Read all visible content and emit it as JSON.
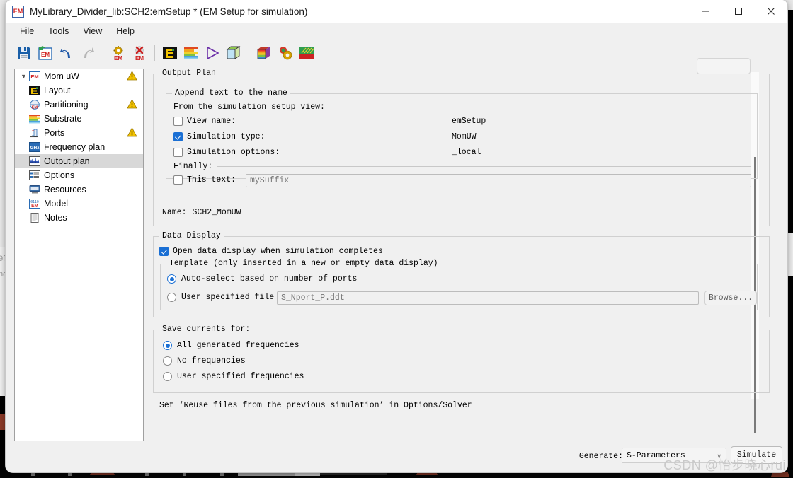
{
  "window": {
    "title": "MyLibrary_Divider_lib:SCH2:emSetup * (EM Setup for simulation)",
    "app_icon": "em-icon",
    "minimize": "—",
    "maximize": "☐",
    "close": "✕"
  },
  "menubar": [
    {
      "label": "File",
      "mnemonic": "F"
    },
    {
      "label": "Tools",
      "mnemonic": "T"
    },
    {
      "label": "View",
      "mnemonic": "V"
    },
    {
      "label": "Help",
      "mnemonic": "H"
    }
  ],
  "toolbar": [
    {
      "name": "save-icon"
    },
    {
      "name": "save-em-setup-icon"
    },
    {
      "name": "undo-icon"
    },
    {
      "name": "redo-icon"
    },
    {
      "sep": true
    },
    {
      "name": "em-settings-icon"
    },
    {
      "name": "em-delete-icon"
    },
    {
      "sep": true
    },
    {
      "name": "layout-icon"
    },
    {
      "name": "substrate-icon"
    },
    {
      "name": "simulate-play-icon"
    },
    {
      "name": "3d-view-icon"
    },
    {
      "sep": true
    },
    {
      "name": "3d-em-preview-icon"
    },
    {
      "name": "em-cosimulation-icon"
    },
    {
      "name": "current-visualization-icon"
    }
  ],
  "sidebar": {
    "root": {
      "label": "Mom uW",
      "icon": "em-icon",
      "expanded": true,
      "warning": true
    },
    "items": [
      {
        "label": "Layout",
        "icon": "layout-icon",
        "warning": false,
        "selected": false
      },
      {
        "label": "Partitioning",
        "icon": "partitioning-icon",
        "warning": true,
        "selected": false
      },
      {
        "label": "Substrate",
        "icon": "substrate-icon",
        "warning": false,
        "selected": false
      },
      {
        "label": "Ports",
        "icon": "ports-icon",
        "warning": true,
        "selected": false
      },
      {
        "label": "Frequency plan",
        "icon": "ghz-icon",
        "warning": false,
        "selected": false
      },
      {
        "label": "Output plan",
        "icon": "output-plan-icon",
        "warning": false,
        "selected": true
      },
      {
        "label": "Options",
        "icon": "options-icon",
        "warning": false,
        "selected": false
      },
      {
        "label": "Resources",
        "icon": "resources-icon",
        "warning": false,
        "selected": false
      },
      {
        "label": "Model",
        "icon": "model-icon",
        "warning": false,
        "selected": false
      },
      {
        "label": "Notes",
        "icon": "notes-icon",
        "warning": false,
        "selected": false
      }
    ]
  },
  "output_plan": {
    "group_label": "Output Plan",
    "append_group_label": "Append text to the name",
    "from_view_label": "From the simulation setup view:",
    "rows": [
      {
        "label": "View name:",
        "checked": false,
        "value": "emSetup"
      },
      {
        "label": "Simulation type:",
        "checked": true,
        "value": "MomUW"
      },
      {
        "label": "Simulation options:",
        "checked": false,
        "value": "_local"
      }
    ],
    "finally_label": "Finally:",
    "this_text_label": "This text:",
    "this_text_checked": false,
    "this_text_placeholder": "mySuffix",
    "this_text_value": "",
    "name_label": "Name:",
    "name_value": "SCH2_MomUW"
  },
  "data_display": {
    "group_label": "Data Display",
    "open_on_complete_label": "Open data display when simulation completes",
    "open_on_complete_checked": true,
    "template_group_label": "Template (only inserted in a new or empty data display)",
    "auto_select_label": "Auto-select based on number of ports",
    "user_file_label": "User specified file",
    "selected_option": "auto",
    "user_file_placeholder": "S_Nport_P.ddt",
    "user_file_value": "",
    "browse_label": "Browse..."
  },
  "save_currents": {
    "group_label": "Save currents for:",
    "options": [
      {
        "label": "All generated frequencies",
        "selected": true
      },
      {
        "label": "No frequencies",
        "selected": false
      },
      {
        "label": "User specified frequencies",
        "selected": false
      }
    ],
    "hint": "Set ‘Reuse files from the previous simulation’ in Options/Solver"
  },
  "bottom_bar": {
    "generate_label": "Generate:",
    "generate_value": "S-Parameters",
    "generate_caret": "∨",
    "simulate_label": "Simulate"
  },
  "watermark": "CSDN @怡步晓心rui",
  "colors": {
    "accent": "#1a6fd4",
    "window_bg": "#f0f0f0",
    "tree_bg": "#ffffff",
    "selection": "#d8d8d8",
    "warning": "#f2c200",
    "border": "#d0d0d0"
  }
}
